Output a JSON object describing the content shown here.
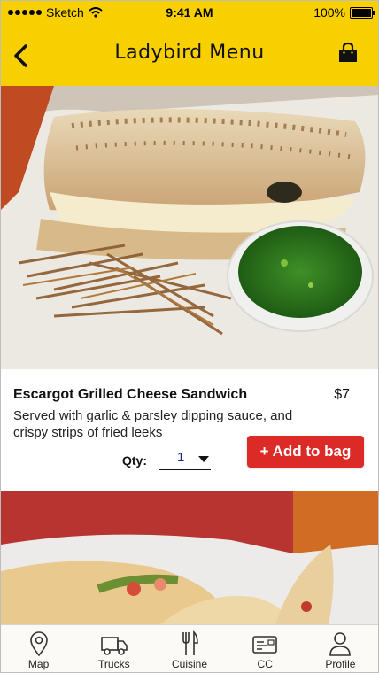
{
  "status_bar": {
    "carrier": "Sketch",
    "time": "9:41 AM",
    "battery": "100%"
  },
  "nav": {
    "title": "Ladybird Menu"
  },
  "item": {
    "name": "Escargot Grilled Cheese Sandwich",
    "price": "$7",
    "description": "Served with garlic & parsley dipping sauce, and crispy strips of fried leeks",
    "qty_label": "Qty:",
    "qty_value": "1",
    "add_button_label": "+ Add to bag"
  },
  "tabs": [
    {
      "label": "Map",
      "icon": "map-pin-icon"
    },
    {
      "label": "Trucks",
      "icon": "truck-icon"
    },
    {
      "label": "Cuisine",
      "icon": "cutlery-icon"
    },
    {
      "label": "CC",
      "icon": "card-icon"
    },
    {
      "label": "Profile",
      "icon": "person-icon"
    }
  ],
  "colors": {
    "header": "#f8cf00",
    "button": "#dc2a26"
  }
}
